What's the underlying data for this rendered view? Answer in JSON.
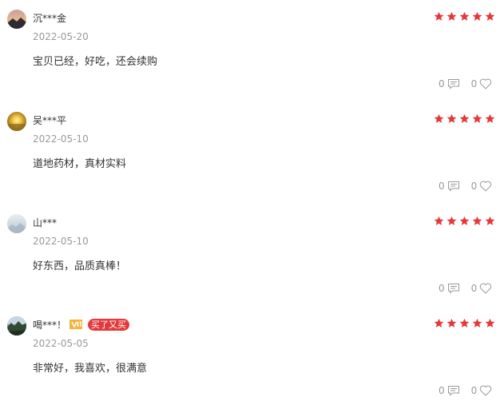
{
  "reviews": [
    {
      "username": "沉***金",
      "date": "2022-05-20",
      "rating": 5,
      "content": "宝贝已经，好吃，还会续购",
      "comment_count": "0",
      "like_count": "0",
      "avatar_icon": "sunset-mountain-avatar",
      "badges": null
    },
    {
      "username": "吴***平",
      "date": "2022-05-10",
      "rating": 5,
      "content": "道地药材，真材实料",
      "comment_count": "0",
      "like_count": "0",
      "avatar_icon": "golden-sun-avatar",
      "badges": null
    },
    {
      "username": "山***",
      "date": "2022-05-10",
      "rating": 5,
      "content": "好东西，品质真棒！",
      "comment_count": "0",
      "like_count": "0",
      "avatar_icon": "misty-snow-avatar",
      "badges": null
    },
    {
      "username": "喝***！",
      "date": "2022-05-05",
      "rating": 5,
      "content": "非常好，我喜欢，很满意",
      "comment_count": "0",
      "like_count": "0",
      "avatar_icon": "forest-landscape-avatar",
      "badges": {
        "vip_icon": "vip-crown-icon",
        "repurchase_label": "买了又买"
      }
    }
  ],
  "colors": {
    "star": "#e4393c",
    "badge_bg": "#e4393c",
    "vip_gold": "#f4b43a",
    "muted_text": "#999999",
    "body_text": "#333333"
  }
}
